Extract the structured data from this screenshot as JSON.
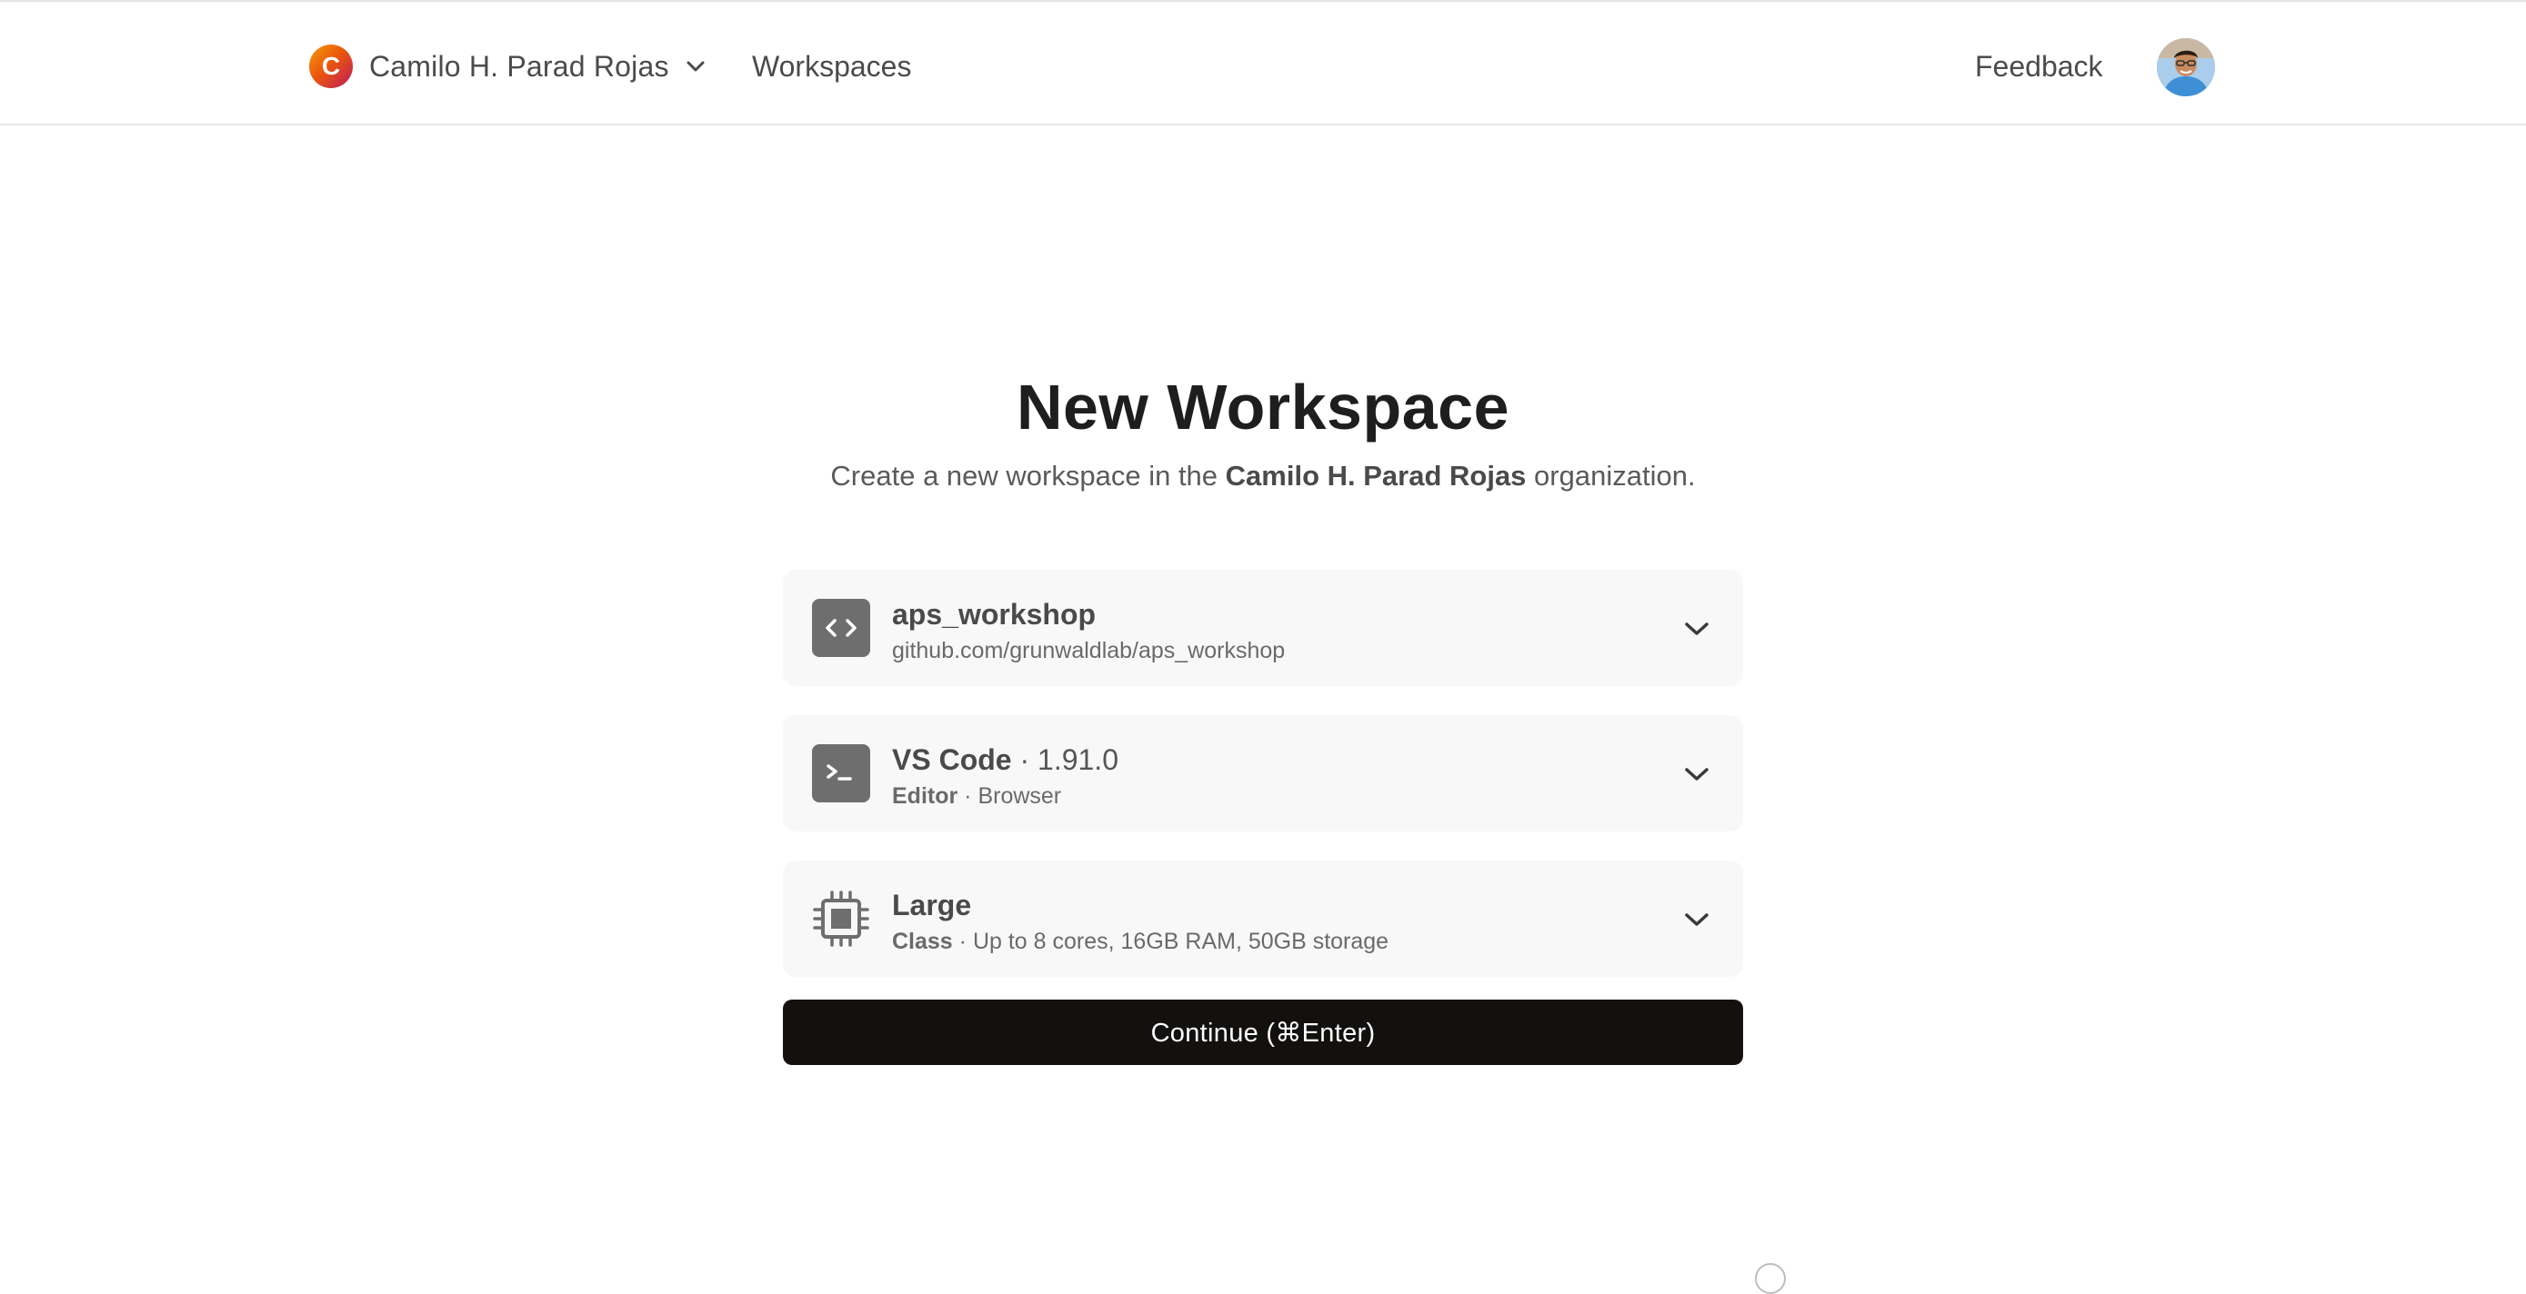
{
  "topbar": {
    "org_initial": "C",
    "org_name": "Camilo H. Parad Rojas",
    "nav_workspaces": "Workspaces",
    "nav_feedback": "Feedback"
  },
  "main": {
    "title": "New Workspace",
    "subtitle_prefix": "Create a new workspace in the ",
    "subtitle_org": "Camilo H. Parad Rojas",
    "subtitle_suffix": " organization."
  },
  "repository": {
    "name": "aps_workshop",
    "url": "github.com/grunwaldlab/aps_workshop",
    "icon": "code-brackets-icon"
  },
  "editor": {
    "name": "VS Code",
    "separator": " · ",
    "version": "1.91.0",
    "label": "Editor",
    "dot": " · ",
    "mode": "Browser",
    "icon": "terminal-icon"
  },
  "machine_class": {
    "name": "Large",
    "label": "Class",
    "dot": " · ",
    "spec": "Up to 8 cores, 16GB RAM, 50GB storage",
    "icon": "cpu-chip-icon"
  },
  "actions": {
    "continue_label": "Continue (⌘Enter)"
  },
  "colors": {
    "accent_button": "#12110f",
    "card_background": "#f8f8f8",
    "icon_fill": "#6e6e6e"
  }
}
